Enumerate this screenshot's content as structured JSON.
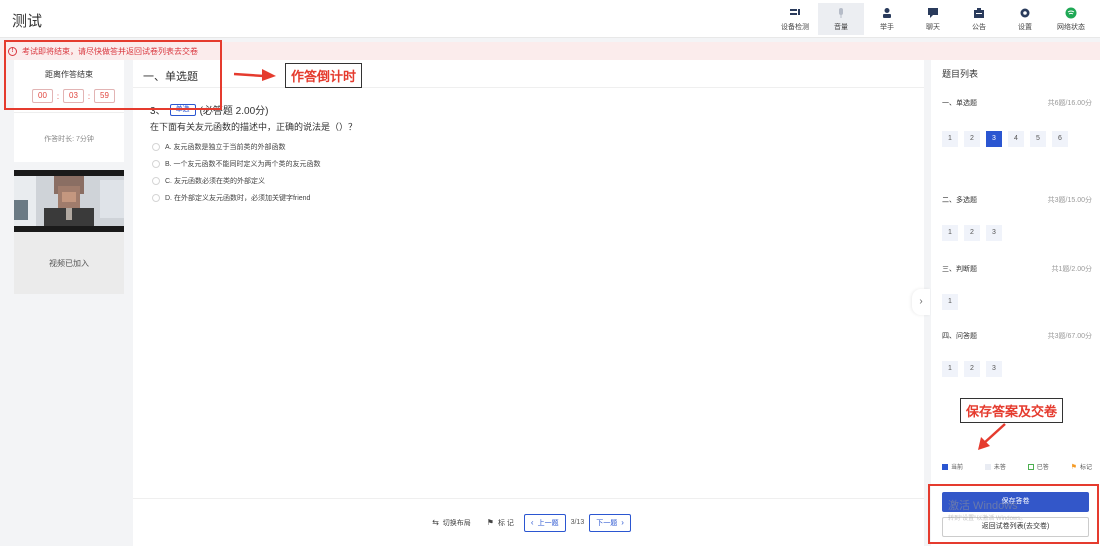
{
  "header": {
    "title": "测试",
    "tools": [
      {
        "label": "设备检测",
        "icon": "device-check-icon"
      },
      {
        "label": "音量",
        "icon": "microphone-icon"
      },
      {
        "label": "举手",
        "icon": "raise-hand-icon"
      },
      {
        "label": "聊天",
        "icon": "chat-icon"
      },
      {
        "label": "公告",
        "icon": "announcement-icon"
      },
      {
        "label": "设置",
        "icon": "gear-icon"
      },
      {
        "label": "网络状态",
        "icon": "network-status-icon"
      }
    ]
  },
  "warning": {
    "text": "考试即将结束，请尽快做答并返回试卷列表去交卷",
    "icon": "alert-circle-icon",
    "color": "#d9363e"
  },
  "timer": {
    "title": "距离作答结束",
    "hours": "00",
    "minutes": "03",
    "seconds": "59",
    "separator": ":",
    "elapsed": "作答时长: 7分钟"
  },
  "video": {
    "status": "视频已加入"
  },
  "question": {
    "section_title": "一、单选题",
    "number": "3、",
    "type_tag": "单选",
    "score_info": "(必答题 2.00分)",
    "text": "在下面有关友元函数的描述中，正确的说法是（）？",
    "options": [
      "A. 友元函数是独立于当前类的外部函数",
      "B. 一个友元函数不能同时定义为两个类的友元函数",
      "C. 友元函数必须在类的外部定义",
      "D. 在外部定义友元函数时，必须加关键字friend"
    ]
  },
  "nav": {
    "switch_layout": "切换布局",
    "mark": "标 记",
    "prev": "上一题",
    "page": "3/13",
    "next": "下一题"
  },
  "question_list": {
    "title": "题目列表",
    "groups": [
      {
        "name": "一、单选题",
        "total": "共6题/16.00分",
        "numbers": [
          "1",
          "2",
          "3",
          "4",
          "5",
          "6"
        ],
        "current": "3"
      },
      {
        "name": "二、多选题",
        "total": "共3题/15.00分",
        "numbers": [
          "1",
          "2",
          "3"
        ]
      },
      {
        "name": "三、判断题",
        "total": "共1题/2.00分",
        "numbers": [
          "1"
        ]
      },
      {
        "name": "四、问答题",
        "total": "共3题/67.00分",
        "numbers": [
          "1",
          "2",
          "3"
        ]
      }
    ],
    "legend": [
      {
        "label": "当前",
        "color": "#2b56d1"
      },
      {
        "label": "未答",
        "color": "#e9ecf3"
      },
      {
        "label": "已答",
        "color": "#4caf50"
      },
      {
        "label": "标记",
        "color": "#f59a23"
      }
    ],
    "save_button": "保存答卷",
    "return_button": "返回试卷列表(去交卷)"
  },
  "watermark": {
    "line1": "激活 Windows",
    "line2": "转到\"设置\"以激活 Windows。"
  },
  "annotations": {
    "timer_label": "作答倒计时",
    "save_label": "保存答案及交卷",
    "color": "#e53b2e"
  }
}
